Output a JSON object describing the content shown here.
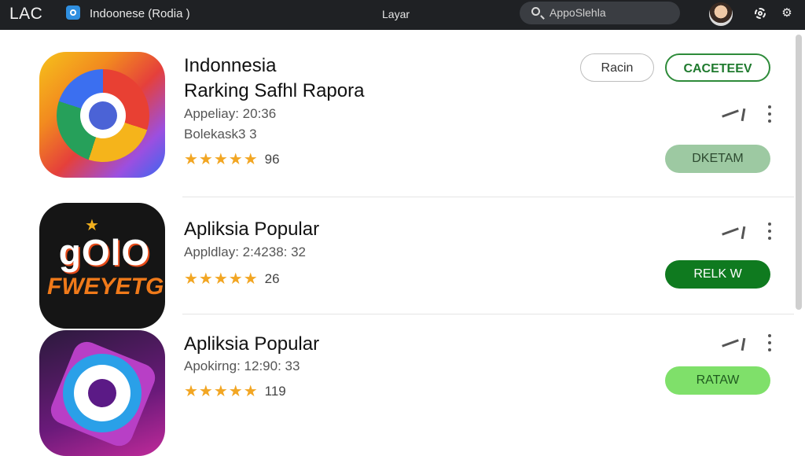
{
  "topbar": {
    "brand": "LAC",
    "title": "Indoonese (Rodia )",
    "center_label": "Layar",
    "search": {
      "placeholder": "AppoSlehla"
    },
    "icons": [
      "app-store-icon",
      "search-icon",
      "avatar",
      "gear-icon",
      "tune-icon"
    ]
  },
  "apps": [
    {
      "name_line1": "Indonnesia",
      "name_line2": "Rarking Safhl Rapora",
      "meta1": "Appeliay: 20:36",
      "meta2": "Bolekask3 3",
      "stars": "★★★★★",
      "rating": "96",
      "buttons": {
        "secondary": "Racin",
        "primary": "CACETEEV",
        "action": "DKETAM"
      },
      "accent": "#9dc9a2"
    },
    {
      "name": "Apliksia Popular",
      "meta1": "Appldlay: 2:4238: 32",
      "stars": "★★★★★",
      "rating": "26",
      "buttons": {
        "action": "RELK W"
      },
      "accent": "#0f7a1f",
      "logo_text_top": "gOlO",
      "logo_text_bottom": "FWEYETG"
    },
    {
      "name": "Apliksia Popular",
      "meta1": "Apokirng: 12:90: 33",
      "stars": "★★★★★",
      "rating": "119",
      "buttons": {
        "action": "RATAW"
      },
      "accent": "#7fe06a"
    }
  ],
  "colors": {
    "topbar_bg": "#1f2124",
    "green_primary": "#2e8b3a",
    "star": "#f2a623"
  }
}
